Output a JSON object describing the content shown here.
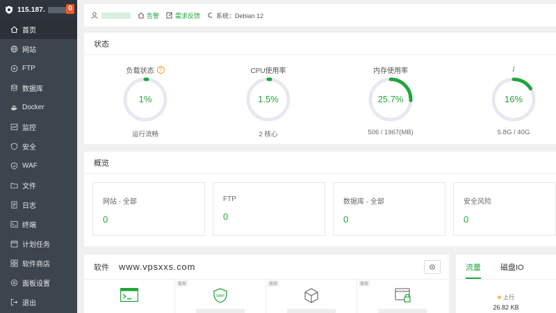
{
  "sidebar": {
    "ip": "115.187.",
    "badge": "0",
    "items": [
      {
        "label": "首页",
        "icon": "home-icon"
      },
      {
        "label": "网站",
        "icon": "globe-icon"
      },
      {
        "label": "FTP",
        "icon": "ftp-icon"
      },
      {
        "label": "数据库",
        "icon": "database-icon"
      },
      {
        "label": "Docker",
        "icon": "docker-icon"
      },
      {
        "label": "监控",
        "icon": "monitor-icon"
      },
      {
        "label": "安全",
        "icon": "shield-icon"
      },
      {
        "label": "WAF",
        "icon": "waf-icon"
      },
      {
        "label": "文件",
        "icon": "folder-icon"
      },
      {
        "label": "日志",
        "icon": "log-icon"
      },
      {
        "label": "终端",
        "icon": "terminal-icon"
      },
      {
        "label": "计划任务",
        "icon": "clock-icon"
      },
      {
        "label": "软件商店",
        "icon": "store-icon"
      },
      {
        "label": "面板设置",
        "icon": "settings-icon"
      },
      {
        "label": "退出",
        "icon": "logout-icon"
      }
    ]
  },
  "topbar": {
    "alert": "告警",
    "feedback": "需求反馈",
    "system": "系统：Debian 12"
  },
  "status": {
    "title": "状态",
    "gauges": [
      {
        "label": "负载状态",
        "value": "1%",
        "percent": 1,
        "sub": "运行流畅"
      },
      {
        "label": "CPU使用率",
        "value": "1.5%",
        "percent": 1.5,
        "sub": "2 核心"
      },
      {
        "label": "内存使用率",
        "value": "25.7%",
        "percent": 25.7,
        "sub": "506 / 1967(MB)"
      },
      {
        "label": "/",
        "value": "16%",
        "percent": 16,
        "sub": "5.8G / 40G"
      }
    ]
  },
  "overview": {
    "title": "概览",
    "cards": [
      {
        "label": "网站 - 全部",
        "value": "0"
      },
      {
        "label": "FTP",
        "value": "0"
      },
      {
        "label": "数据库 - 全部",
        "value": "0"
      },
      {
        "label": "安全风险",
        "value": "0"
      }
    ]
  },
  "software": {
    "title": "软件",
    "watermark": "www.vpsxxs.com",
    "tag": "推荐",
    "items": [
      {
        "icon": "terminal-icon"
      },
      {
        "icon": "waf-icon"
      },
      {
        "icon": "box-icon"
      },
      {
        "icon": "lock-window-icon"
      }
    ]
  },
  "traffic": {
    "tabs": [
      "流量",
      "磁盘IO"
    ],
    "up_label": "上行",
    "up_value": "26.82 KB"
  },
  "colors": {
    "accent": "#20a53a",
    "sidebar": "#3c444d",
    "badge": "#f0592b"
  }
}
